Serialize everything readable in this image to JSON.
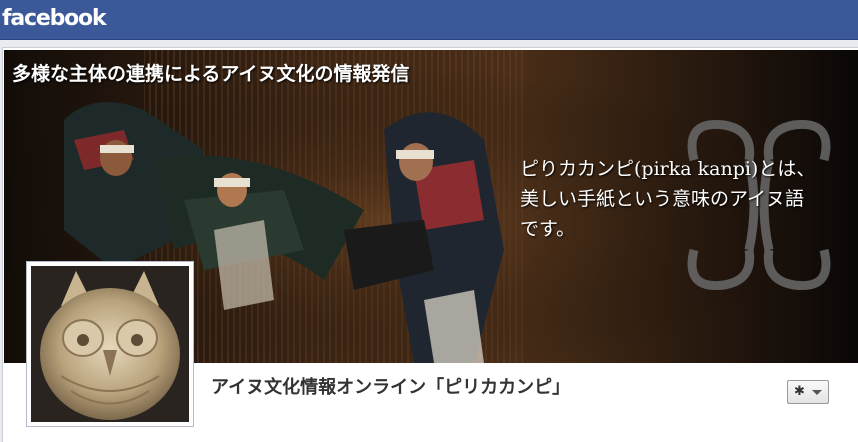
{
  "app": {
    "brand": "facebook",
    "brand_color": "#3b5998"
  },
  "cover": {
    "title": "多様な主体の連携によるアイヌ文化の情報発信",
    "description_lines": [
      "ピりカカンピ(pirka kanpi)とは、",
      "美しい手紙という意味のアイヌ語",
      "です。"
    ],
    "image": "ainu-dance-photo",
    "emblem_icon": "ainu-pattern-icon"
  },
  "profile": {
    "picture": "owl-carving-photo",
    "page_name": "アイヌ文化情報オンライン「ピリカカンピ」"
  },
  "actions": {
    "settings_icon": "gear-icon",
    "dropdown_icon": "chevron-down-icon"
  }
}
